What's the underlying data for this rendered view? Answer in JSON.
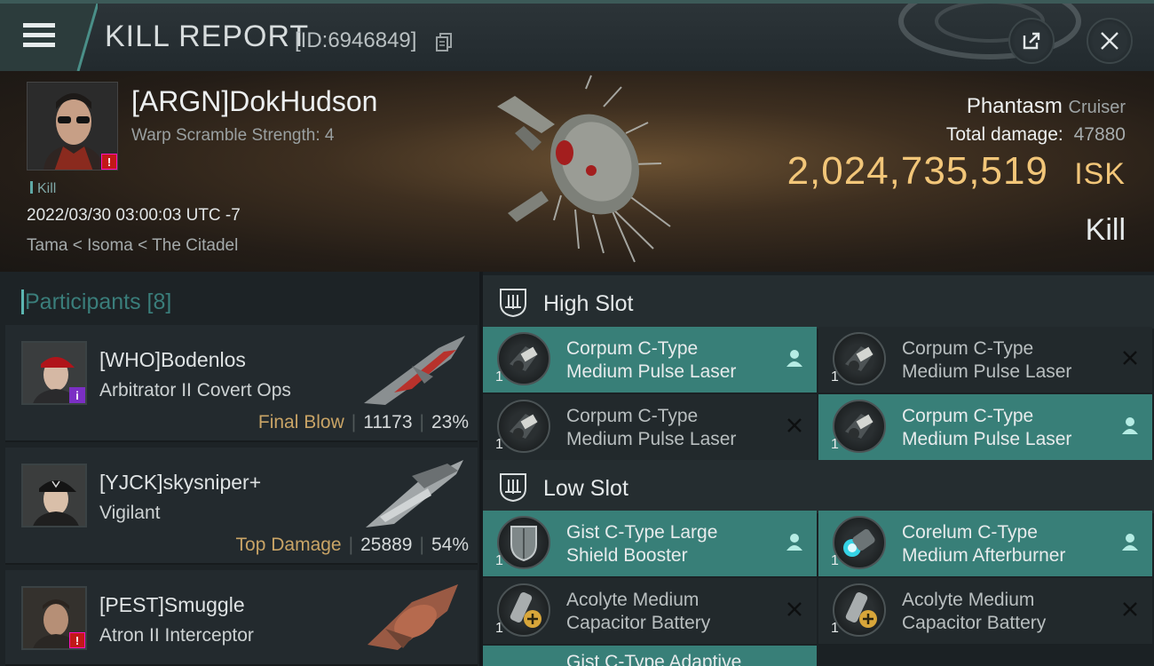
{
  "topbar": {
    "title": "KILL REPORT",
    "report_id": "[ID:6946849]",
    "menu_icon": "hamburger-menu-icon",
    "share_icon": "share-export-icon",
    "close_icon": "close-icon"
  },
  "victim": {
    "name": "[ARGN]DokHudson",
    "warp_scramble": "Warp Scramble Strength: 4",
    "kill_tag": "Kill",
    "datetime": "2022/03/30 03:00:03 UTC -7",
    "location": "Tama < Isoma < The Citadel",
    "ship_name": "Phantasm",
    "ship_class": "Cruiser",
    "total_damage_label": "Total damage:",
    "total_damage": "47880",
    "isk_value": "2,024,735,519",
    "isk_unit": "ISK",
    "result": "Kill",
    "badge": "!"
  },
  "participants": {
    "title": "Participants [8]",
    "rows": [
      {
        "name": "[WHO]Bodenlos",
        "ship": "Arbitrator II Covert Ops",
        "tag": "Final Blow",
        "damage": "11173",
        "percent": "23%",
        "badge": "i",
        "badge_color": "#7b2fc4"
      },
      {
        "name": "[YJCK]skysniper+",
        "ship": "Vigilant",
        "tag": "Top Damage",
        "damage": "25889",
        "percent": "54%",
        "badge": "",
        "badge_color": ""
      },
      {
        "name": "[PEST]Smuggle",
        "ship": "Atron II Interceptor",
        "tag": "",
        "damage": "",
        "percent": "",
        "badge": "!",
        "badge_color": "#c21818"
      }
    ]
  },
  "fittings": {
    "high_slot": {
      "title": "High Slot",
      "modules": [
        {
          "line1": "Corpum C-Type",
          "line2": "Medium Pulse Laser",
          "qty": "1",
          "state": "dropped"
        },
        {
          "line1": "Corpum C-Type",
          "line2": "Medium Pulse Laser",
          "qty": "1",
          "state": "destroyed"
        },
        {
          "line1": "Corpum C-Type",
          "line2": "Medium Pulse Laser",
          "qty": "1",
          "state": "destroyed"
        },
        {
          "line1": "Corpum C-Type",
          "line2": "Medium Pulse Laser",
          "qty": "1",
          "state": "dropped"
        }
      ]
    },
    "low_slot": {
      "title": "Low Slot",
      "modules": [
        {
          "line1": "Gist C-Type Large",
          "line2": "Shield Booster",
          "qty": "1",
          "state": "dropped"
        },
        {
          "line1": "Corelum C-Type",
          "line2": "Medium Afterburner",
          "qty": "1",
          "state": "dropped"
        },
        {
          "line1": "Acolyte Medium",
          "line2": "Capacitor Battery",
          "qty": "1",
          "state": "destroyed"
        },
        {
          "line1": "Acolyte Medium",
          "line2": "Capacitor Battery",
          "qty": "1",
          "state": "destroyed"
        }
      ]
    },
    "partial_next": "Gist C-Type Adaptive"
  },
  "colors": {
    "accent_teal": "#387f78",
    "isk_gold": "#f2c679",
    "tag_gold": "#c9a466"
  }
}
